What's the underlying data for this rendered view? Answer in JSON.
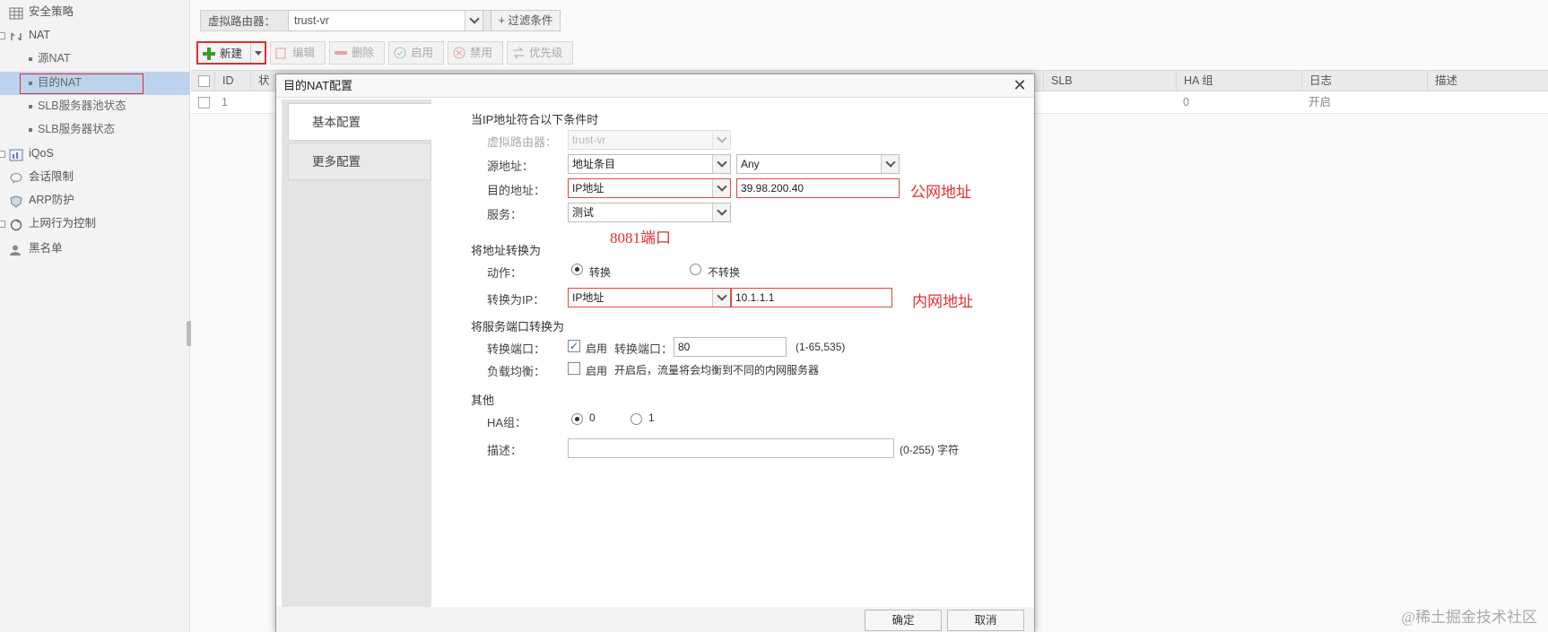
{
  "sidebar": {
    "items": [
      {
        "label": "安全策略",
        "icon": "grid-icon"
      },
      {
        "label": "NAT",
        "icon": "nat-icon"
      },
      {
        "label": "源NAT"
      },
      {
        "label": "目的NAT"
      },
      {
        "label": "SLB服务器池状态"
      },
      {
        "label": "SLB服务器状态"
      },
      {
        "label": "iQoS",
        "icon": "qos-icon"
      },
      {
        "label": "会话限制",
        "icon": "chat-icon"
      },
      {
        "label": "ARP防护",
        "icon": "shield-icon"
      },
      {
        "label": "上网行为控制",
        "icon": "globe-icon"
      },
      {
        "label": "黑名单",
        "icon": "user-icon"
      }
    ]
  },
  "filter": {
    "vr_label": "虚拟路由器：",
    "vr_value": "trust-vr",
    "add_filter": "+ 过滤条件"
  },
  "toolbar": {
    "new": "新建",
    "edit": "编辑",
    "delete": "删除",
    "enable": "启用",
    "disable": "禁用",
    "priority": "优先级"
  },
  "grid": {
    "headers": {
      "id": "ID",
      "status": "状",
      "slb": "SLB",
      "ha": "HA 组",
      "log": "日志",
      "desc": "描述"
    },
    "row": {
      "id": "1",
      "ha": "0",
      "log": "开启"
    }
  },
  "dialog": {
    "title": "目的NAT配置",
    "tabs": [
      "基本配置",
      "更多配置"
    ],
    "section_match": "当IP地址符合以下条件时",
    "vr_label": "虚拟路由器：",
    "vr_value": "trust-vr",
    "src_label": "源地址：",
    "src_type": "地址条目",
    "src_value": "Any",
    "dst_label": "目的地址：",
    "dst_type": "IP地址",
    "dst_value": "39.98.200.40",
    "service_label": "服务：",
    "service_value": "测试",
    "section_translate": "将地址转换为",
    "action_label": "动作：",
    "action_translate": "转换",
    "action_no_translate": "不转换",
    "trans_ip_label": "转换为IP：",
    "trans_ip_type": "IP地址",
    "trans_ip_value": "10.1.1.1",
    "section_port": "将服务端口转换为",
    "port_label": "转换端口：",
    "port_enable": "启用",
    "port_inner_label": "转换端口：",
    "port_value": "80",
    "port_range": "(1-65,535)",
    "lb_label": "负载均衡：",
    "lb_enable": "启用",
    "lb_hint": "开启后，流量将会均衡到不同的内网服务器",
    "section_other": "其他",
    "ha_label": "HA组：",
    "ha_0": "0",
    "ha_1": "1",
    "desc_label": "描述：",
    "desc_value": "",
    "desc_hint": "(0-255) 字符",
    "ok": "确定",
    "cancel": "取消"
  },
  "annotations": {
    "public": "公网地址",
    "port": "8081端口",
    "private": "内网地址"
  },
  "watermark": "@稀土掘金技术社区",
  "colors": {
    "annotation_red": "#e03030",
    "sidebar_selected": "#bcd3ee",
    "new_green": "#3a9b2c"
  }
}
